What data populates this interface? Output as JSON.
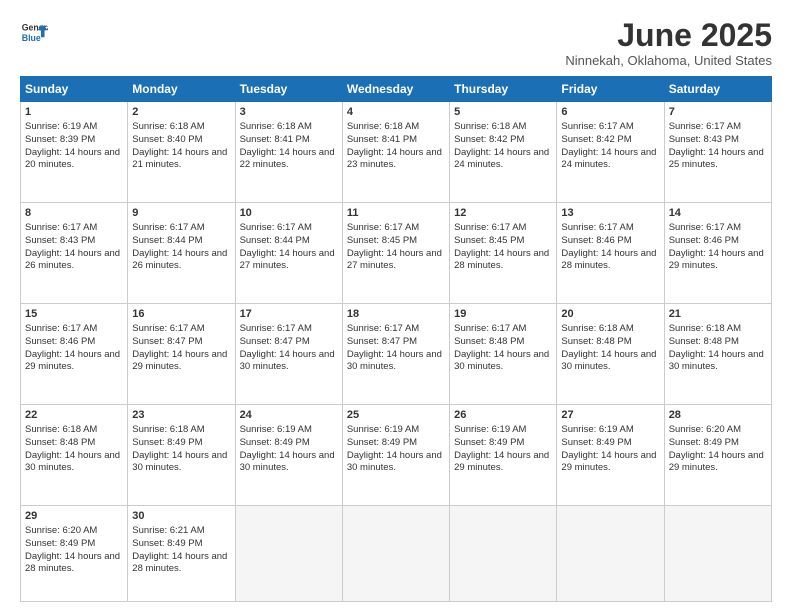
{
  "header": {
    "logo_line1": "General",
    "logo_line2": "Blue",
    "month": "June 2025",
    "location": "Ninnekah, Oklahoma, United States"
  },
  "weekdays": [
    "Sunday",
    "Monday",
    "Tuesday",
    "Wednesday",
    "Thursday",
    "Friday",
    "Saturday"
  ],
  "weeks": [
    [
      {
        "day": "1",
        "sunrise": "6:19 AM",
        "sunset": "8:39 PM",
        "daylight": "14 hours and 20 minutes."
      },
      {
        "day": "2",
        "sunrise": "6:18 AM",
        "sunset": "8:40 PM",
        "daylight": "14 hours and 21 minutes."
      },
      {
        "day": "3",
        "sunrise": "6:18 AM",
        "sunset": "8:41 PM",
        "daylight": "14 hours and 22 minutes."
      },
      {
        "day": "4",
        "sunrise": "6:18 AM",
        "sunset": "8:41 PM",
        "daylight": "14 hours and 23 minutes."
      },
      {
        "day": "5",
        "sunrise": "6:18 AM",
        "sunset": "8:42 PM",
        "daylight": "14 hours and 24 minutes."
      },
      {
        "day": "6",
        "sunrise": "6:17 AM",
        "sunset": "8:42 PM",
        "daylight": "14 hours and 24 minutes."
      },
      {
        "day": "7",
        "sunrise": "6:17 AM",
        "sunset": "8:43 PM",
        "daylight": "14 hours and 25 minutes."
      }
    ],
    [
      {
        "day": "8",
        "sunrise": "6:17 AM",
        "sunset": "8:43 PM",
        "daylight": "14 hours and 26 minutes."
      },
      {
        "day": "9",
        "sunrise": "6:17 AM",
        "sunset": "8:44 PM",
        "daylight": "14 hours and 26 minutes."
      },
      {
        "day": "10",
        "sunrise": "6:17 AM",
        "sunset": "8:44 PM",
        "daylight": "14 hours and 27 minutes."
      },
      {
        "day": "11",
        "sunrise": "6:17 AM",
        "sunset": "8:45 PM",
        "daylight": "14 hours and 27 minutes."
      },
      {
        "day": "12",
        "sunrise": "6:17 AM",
        "sunset": "8:45 PM",
        "daylight": "14 hours and 28 minutes."
      },
      {
        "day": "13",
        "sunrise": "6:17 AM",
        "sunset": "8:46 PM",
        "daylight": "14 hours and 28 minutes."
      },
      {
        "day": "14",
        "sunrise": "6:17 AM",
        "sunset": "8:46 PM",
        "daylight": "14 hours and 29 minutes."
      }
    ],
    [
      {
        "day": "15",
        "sunrise": "6:17 AM",
        "sunset": "8:46 PM",
        "daylight": "14 hours and 29 minutes."
      },
      {
        "day": "16",
        "sunrise": "6:17 AM",
        "sunset": "8:47 PM",
        "daylight": "14 hours and 29 minutes."
      },
      {
        "day": "17",
        "sunrise": "6:17 AM",
        "sunset": "8:47 PM",
        "daylight": "14 hours and 30 minutes."
      },
      {
        "day": "18",
        "sunrise": "6:17 AM",
        "sunset": "8:47 PM",
        "daylight": "14 hours and 30 minutes."
      },
      {
        "day": "19",
        "sunrise": "6:17 AM",
        "sunset": "8:48 PM",
        "daylight": "14 hours and 30 minutes."
      },
      {
        "day": "20",
        "sunrise": "6:18 AM",
        "sunset": "8:48 PM",
        "daylight": "14 hours and 30 minutes."
      },
      {
        "day": "21",
        "sunrise": "6:18 AM",
        "sunset": "8:48 PM",
        "daylight": "14 hours and 30 minutes."
      }
    ],
    [
      {
        "day": "22",
        "sunrise": "6:18 AM",
        "sunset": "8:48 PM",
        "daylight": "14 hours and 30 minutes."
      },
      {
        "day": "23",
        "sunrise": "6:18 AM",
        "sunset": "8:49 PM",
        "daylight": "14 hours and 30 minutes."
      },
      {
        "day": "24",
        "sunrise": "6:19 AM",
        "sunset": "8:49 PM",
        "daylight": "14 hours and 30 minutes."
      },
      {
        "day": "25",
        "sunrise": "6:19 AM",
        "sunset": "8:49 PM",
        "daylight": "14 hours and 30 minutes."
      },
      {
        "day": "26",
        "sunrise": "6:19 AM",
        "sunset": "8:49 PM",
        "daylight": "14 hours and 29 minutes."
      },
      {
        "day": "27",
        "sunrise": "6:19 AM",
        "sunset": "8:49 PM",
        "daylight": "14 hours and 29 minutes."
      },
      {
        "day": "28",
        "sunrise": "6:20 AM",
        "sunset": "8:49 PM",
        "daylight": "14 hours and 29 minutes."
      }
    ],
    [
      {
        "day": "29",
        "sunrise": "6:20 AM",
        "sunset": "8:49 PM",
        "daylight": "14 hours and 28 minutes."
      },
      {
        "day": "30",
        "sunrise": "6:21 AM",
        "sunset": "8:49 PM",
        "daylight": "14 hours and 28 minutes."
      },
      null,
      null,
      null,
      null,
      null
    ]
  ]
}
